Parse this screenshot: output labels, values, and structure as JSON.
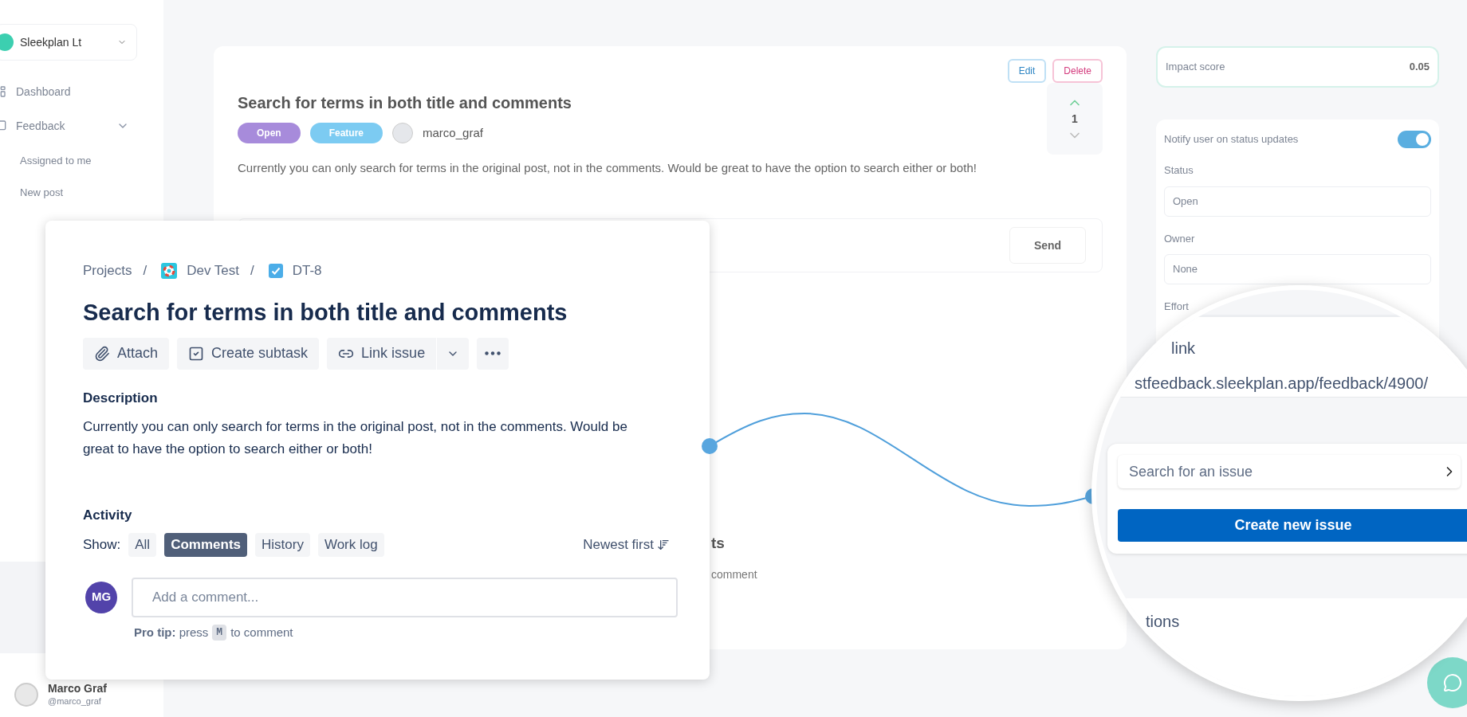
{
  "background": {
    "sidebar": {
      "workspace": "Sleekplan Lt",
      "items": [
        {
          "label": "Dashboard",
          "kind": "link"
        },
        {
          "label": "Feedback",
          "kind": "group"
        },
        {
          "label": "Assigned to me",
          "kind": "sub"
        },
        {
          "label": "New post",
          "kind": "sub"
        }
      ],
      "user": {
        "name": "Marco Graf",
        "handle": "@marco_graf"
      }
    },
    "post": {
      "actions": [
        "Edit",
        "Delete"
      ],
      "title": "Search for terms in both title and comments",
      "tags": [
        {
          "label": "Open",
          "color": "#a78bdb"
        },
        {
          "label": "Feature",
          "color": "#7ccbf2"
        }
      ],
      "author": "marco_graf",
      "votes": "1",
      "body": "Currently you can only search for terms in the original post, not in the comments. Would be great to have the option to search either or both!",
      "send": "Send",
      "fragments": [
        "ts",
        "comment"
      ]
    },
    "panel": {
      "impact_label": "Impact score",
      "impact_value": "0.05",
      "notify": {
        "label": "Notify user on status updates",
        "on": true
      },
      "fields": [
        {
          "label": "Status",
          "value": "Open"
        },
        {
          "label": "Owner",
          "value": "None"
        }
      ],
      "effort_label": "Effort"
    }
  },
  "issue_card": {
    "breadcrumb": [
      {
        "label": "Projects",
        "separator": "/"
      },
      {
        "label": "Dev Test",
        "separator": "/"
      },
      {
        "label": "DT-8"
      }
    ],
    "title": "Search for terms in both title and comments",
    "buttons": [
      "Attach",
      "Create subtask",
      "Link issue"
    ],
    "description_label": "Description",
    "description": "Currently you can only search for terms in the original post, not in the comments. Would be great to have the option to search either or both!",
    "activity_label": "Activity",
    "show_label": "Show:",
    "filters": [
      {
        "label": "All",
        "selected": false
      },
      {
        "label": "Comments",
        "selected": true
      },
      {
        "label": "History",
        "selected": false
      },
      {
        "label": "Work log",
        "selected": false
      }
    ],
    "sort": "Newest first",
    "avatar": "MG",
    "comment_placeholder": "Add a comment...",
    "pro_tip": {
      "before": "**Pro tip:** press",
      "key": "M",
      "after": "to comment"
    }
  },
  "magnifier": {
    "link_label": "link",
    "link_url": "stfeedback.sleekplan.app/feedback/4900/",
    "search_placeholder": "Search for an issue",
    "create_button": "Create new issue",
    "section_label": "tions"
  }
}
